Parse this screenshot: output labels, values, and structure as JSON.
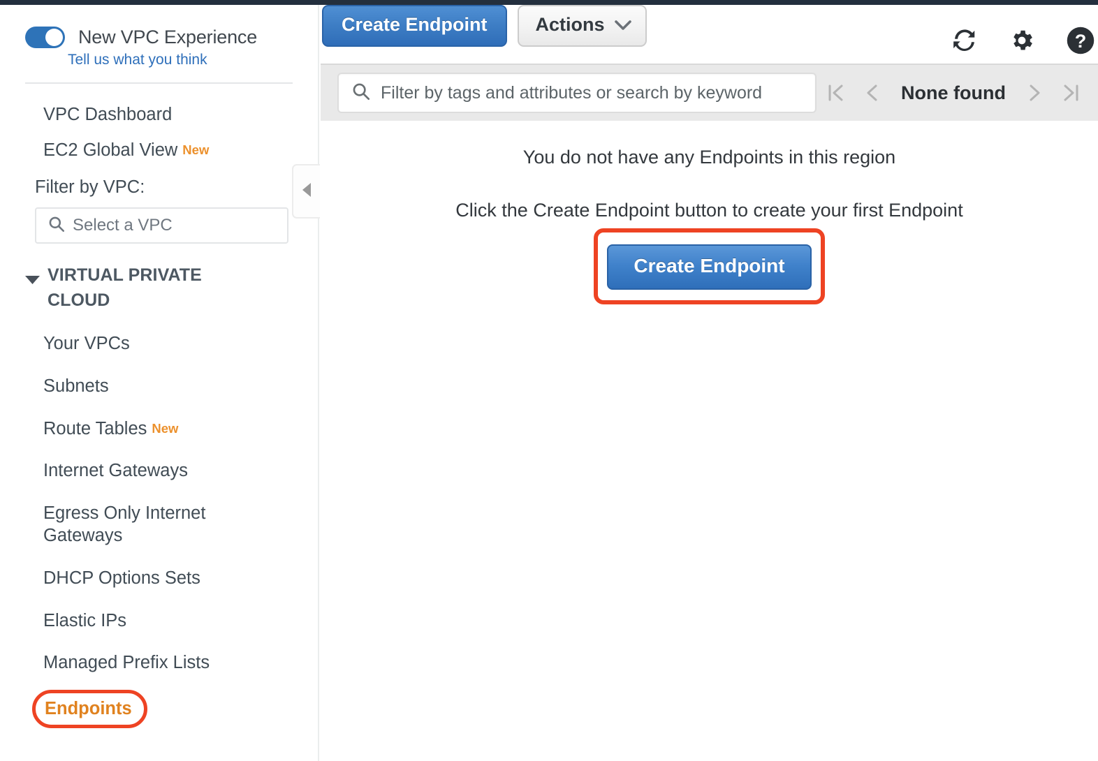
{
  "sidebar": {
    "toggle": {
      "label": "New VPC Experience",
      "enabled": true,
      "color": "#2e73b8"
    },
    "feedback_link": "Tell us what you think",
    "top_nav": [
      {
        "label": "VPC Dashboard",
        "badge": ""
      },
      {
        "label": "EC2 Global View",
        "badge": "New"
      }
    ],
    "filter": {
      "label": "Filter by VPC:",
      "placeholder": "Select a VPC",
      "value": "",
      "icon": "search-icon"
    },
    "section": {
      "title": "VIRTUAL PRIVATE CLOUD",
      "expanded": true,
      "caret_icon": "caret-down-icon"
    },
    "items": [
      {
        "label": "Your VPCs",
        "badge": "",
        "selected": false
      },
      {
        "label": "Subnets",
        "badge": "",
        "selected": false
      },
      {
        "label": "Route Tables",
        "badge": "New",
        "selected": false
      },
      {
        "label": "Internet Gateways",
        "badge": "",
        "selected": false
      },
      {
        "label": "Egress Only Internet Gateways",
        "badge": "",
        "selected": false
      },
      {
        "label": "DHCP Options Sets",
        "badge": "",
        "selected": false
      },
      {
        "label": "Elastic IPs",
        "badge": "",
        "selected": false
      },
      {
        "label": "Managed Prefix Lists",
        "badge": "",
        "selected": false
      }
    ],
    "selected_item": {
      "label": "Endpoints",
      "text_color": "#e0821f",
      "annotation_color": "#ee4323"
    },
    "collapse_handle_icon": "caret-left-icon",
    "new_badge_color": "#ec912d"
  },
  "toolbar": {
    "create_label": "Create Endpoint",
    "actions_label": "Actions",
    "actions_caret_icon": "chevron-down-icon",
    "primary_color": "#2f6db8",
    "icons": [
      {
        "name": "refresh-icon"
      },
      {
        "name": "gear-icon"
      },
      {
        "name": "help-icon"
      }
    ]
  },
  "filter_bar": {
    "placeholder": "Filter by tags and attributes or search by keyword",
    "value": "",
    "icon": "search-icon",
    "pagination": {
      "count_text": "None found",
      "first_icon": "page-first-icon",
      "prev_icon": "page-prev-icon",
      "next_icon": "page-next-icon",
      "last_icon": "page-last-icon"
    }
  },
  "empty_state": {
    "line1": "You do not have any Endpoints in this region",
    "line2": "Click the Create Endpoint button to create your first Endpoint",
    "cta_label": "Create Endpoint",
    "annotation_color": "#ee4323"
  }
}
